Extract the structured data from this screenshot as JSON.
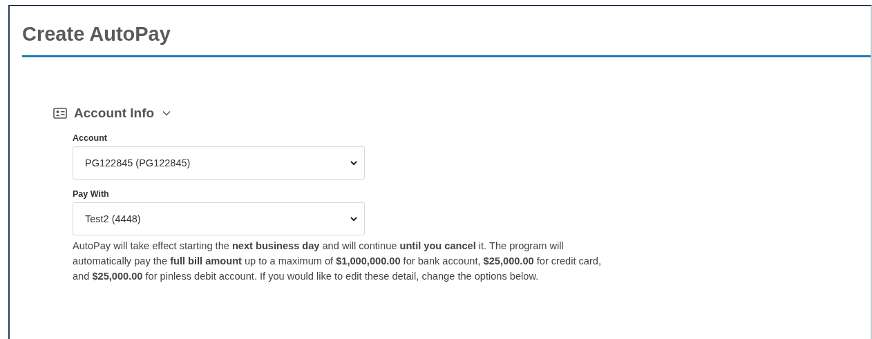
{
  "page": {
    "title": "Create AutoPay"
  },
  "section": {
    "title": "Account Info",
    "expanded": true
  },
  "fields": [
    {
      "label": "Account",
      "value": "PG122845 (PG122845)"
    },
    {
      "label": "Pay With",
      "value": "Test2 (4448)"
    }
  ],
  "notice": "AutoPay will take effect starting the **next business day** and will continue **until you cancel** it. The program will automatically pay the **full bill amount** up to a maximum of **$1,000,000.00** for bank account, **$25,000.00** for credit card, and **$25,000.00** for pinless debit account. If you would like to edit these detail, change the options below."
}
